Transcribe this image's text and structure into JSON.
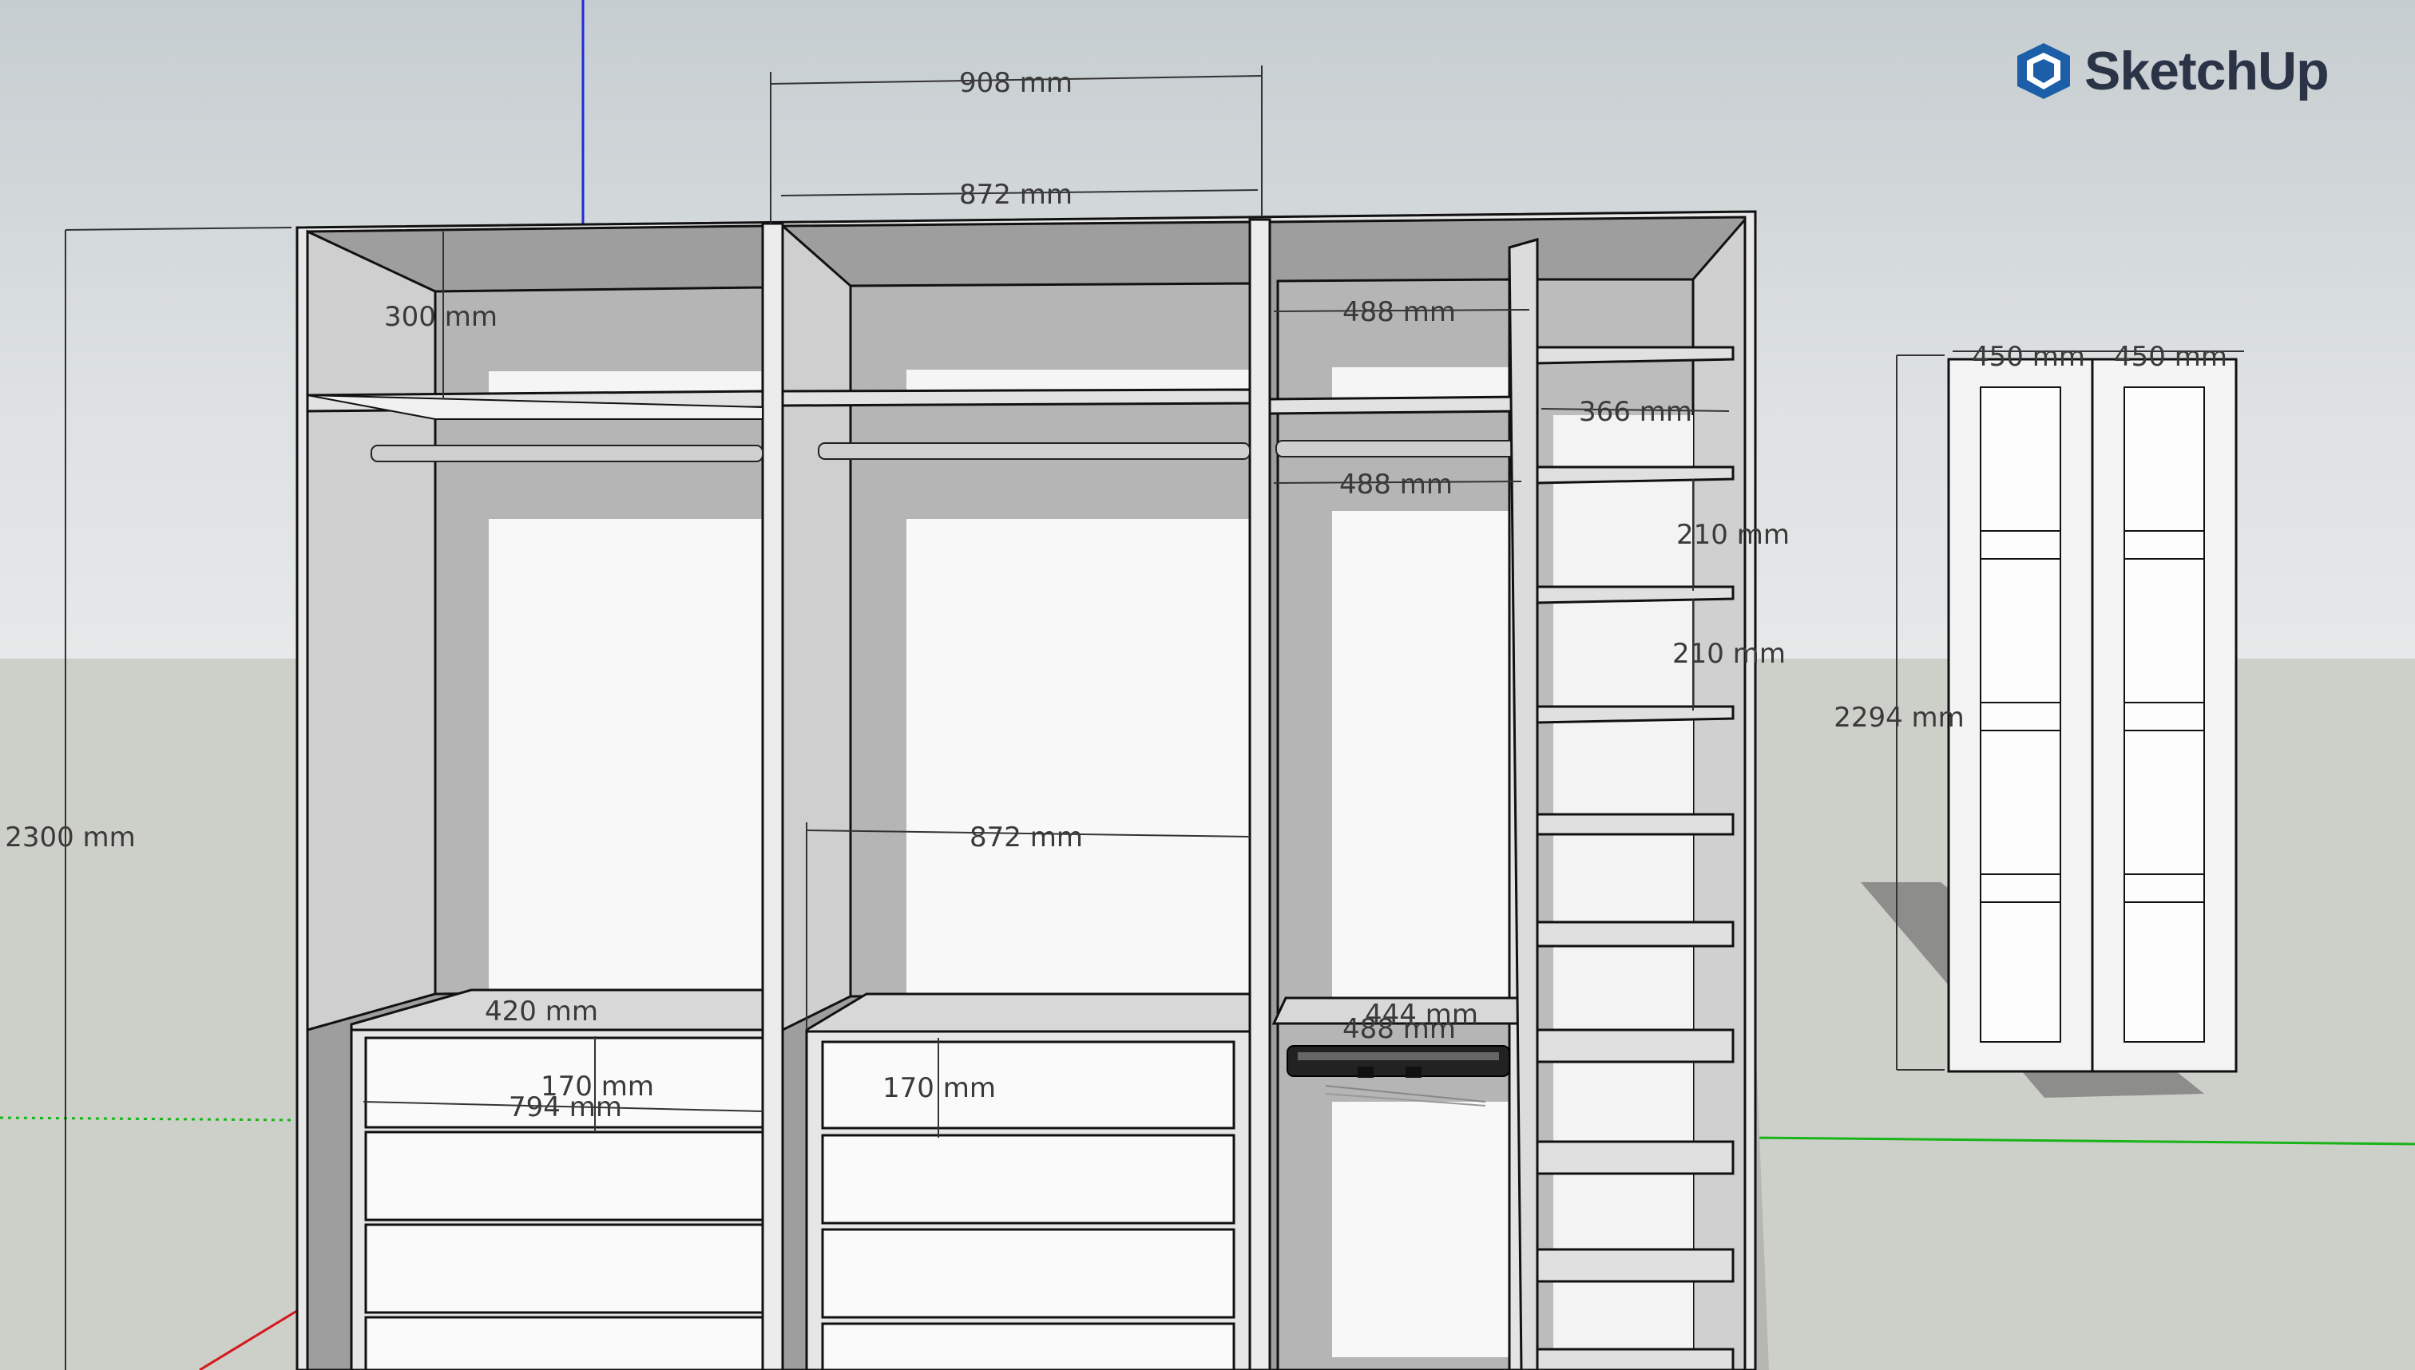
{
  "app": {
    "logo_text": "SketchUp",
    "logo_icon": "sketchup-cube-icon",
    "brand_color": "#1c5fa8"
  },
  "dimensions": {
    "top_outer": "908 mm",
    "top_inner": "872 mm",
    "top_shelf_height": "300 mm",
    "right_top_width": "488 mm",
    "right_shelf_width": "366 mm",
    "right_mid_width": "488 mm",
    "shelf_gap_1": "210 mm",
    "shelf_gap_2": "210 mm",
    "total_height": "2300 mm",
    "middle_width": "872 mm",
    "drawer_depth": "420 mm",
    "drawer_height_left": "170 mm",
    "drawer_width": "794 mm",
    "drawer_height_mid": "170 mm",
    "basket_width": "488 mm",
    "basket_depth": "444 mm",
    "door_width_left": "450 mm",
    "door_width_right": "450 mm",
    "door_height": "2294 mm"
  }
}
